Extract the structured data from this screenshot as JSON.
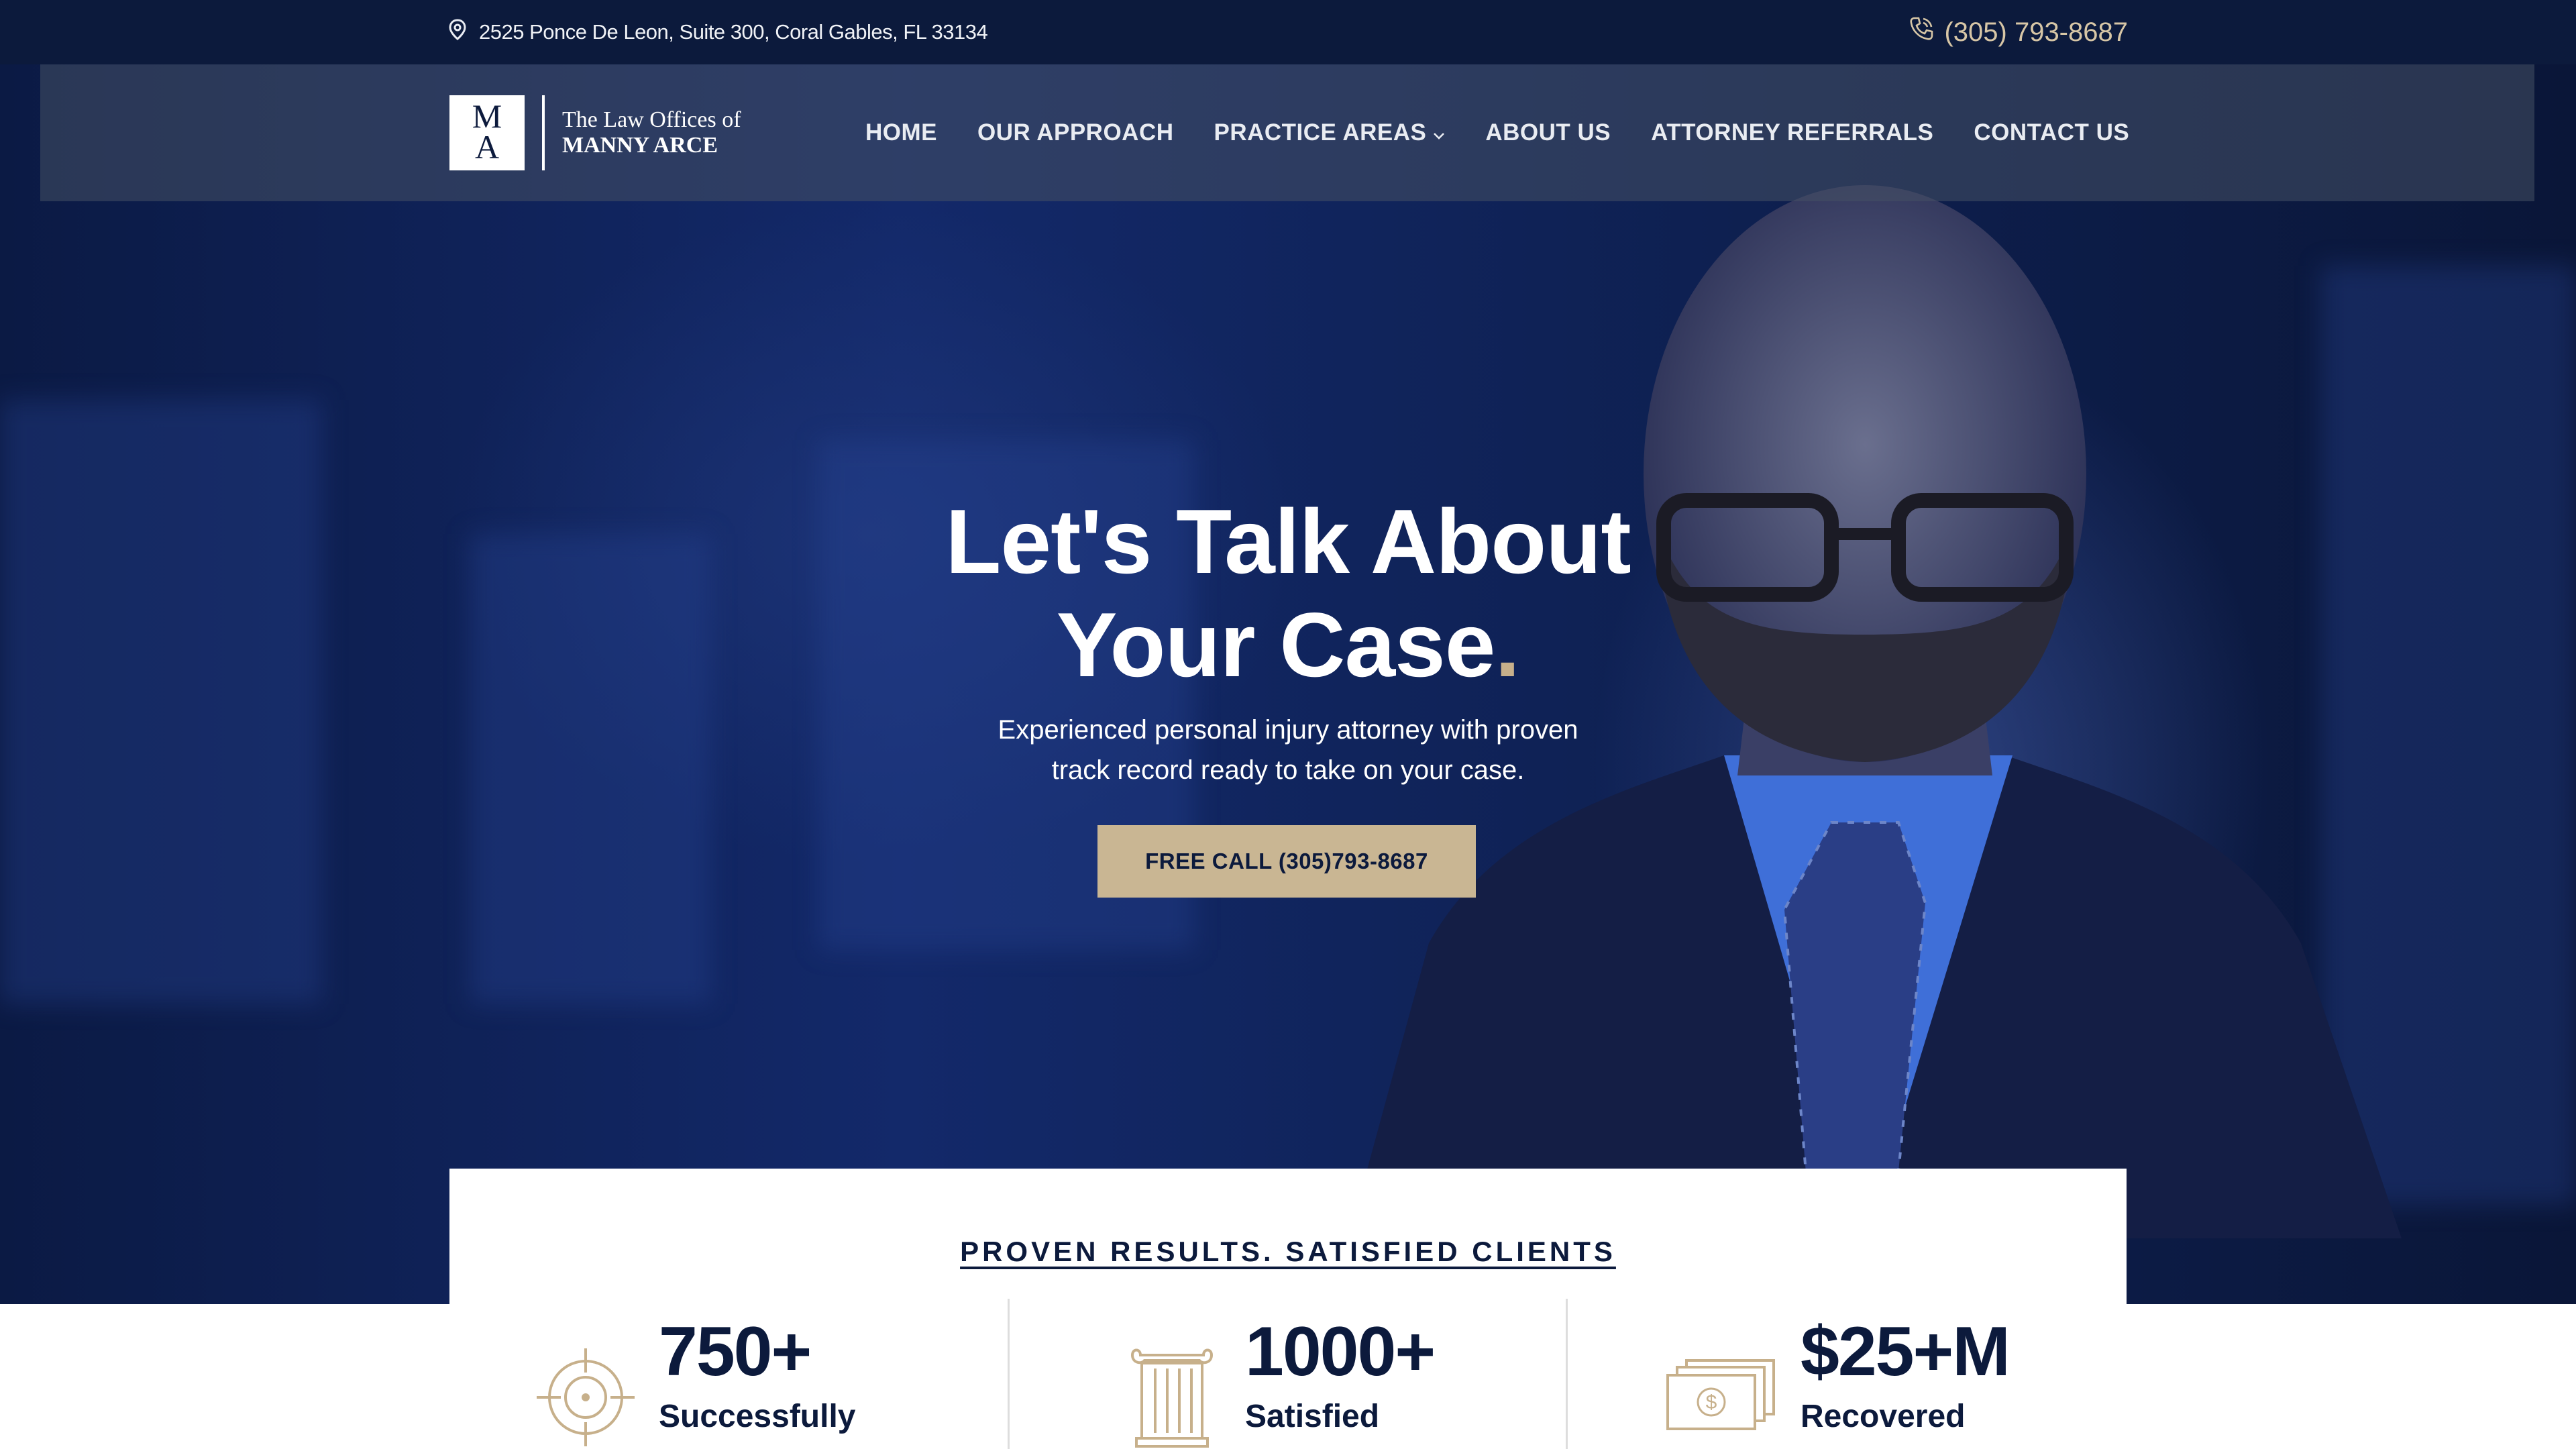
{
  "topbar": {
    "address": "2525 Ponce De Leon, Suite 300, Coral Gables, FL 33134",
    "phone": "(305) 793-8687",
    "location_icon": "location-pin-icon",
    "phone_icon": "phone-icon"
  },
  "logo": {
    "monogram_top": "M",
    "monogram_bottom": "A",
    "line1": "The Law Offices of",
    "line2": "MANNY ARCE"
  },
  "nav": {
    "items": [
      {
        "label": "HOME"
      },
      {
        "label": "OUR APPROACH"
      },
      {
        "label": "PRACTICE AREAS"
      },
      {
        "label": "ABOUT US"
      },
      {
        "label": "ATTORNEY REFERRALS"
      },
      {
        "label": "CONTACT US"
      }
    ]
  },
  "hero": {
    "headline_line1": "Let's Talk About",
    "headline_line2": "Your Case",
    "headline_dot": ".",
    "subtitle_line1": "Experienced personal injury attorney with proven",
    "subtitle_line2": "track record ready to take on your case.",
    "cta_label": "FREE CALL (305)793-8687"
  },
  "results": {
    "title": "PROVEN RESULTS. SATISFIED CLIENTS",
    "stats": [
      {
        "number": "750+",
        "label": "Successfully",
        "icon": "target-icon"
      },
      {
        "number": "1000+",
        "label": "Satisfied",
        "icon": "column-icon"
      },
      {
        "number": "$25+M",
        "label": "Recovered",
        "icon": "money-icon"
      }
    ]
  },
  "colors": {
    "navy": "#0c1a3c",
    "gold": "#c9b693",
    "white": "#ffffff"
  }
}
